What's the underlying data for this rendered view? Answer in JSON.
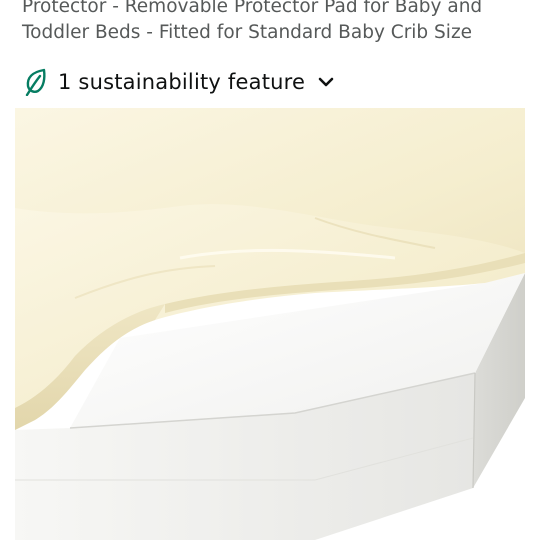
{
  "product": {
    "title_line1": "Protector - Removable Protector Pad for Baby and",
    "title_line2": "Toddler Beds - Fitted for Standard Baby Crib Size"
  },
  "sustainability": {
    "label": "1 sustainability feature",
    "icon": "leaf-icon",
    "expand_icon": "chevron-down-icon",
    "accent": "#067D62"
  },
  "image": {
    "subject": "mattress-with-fitted-sheet-photo"
  }
}
